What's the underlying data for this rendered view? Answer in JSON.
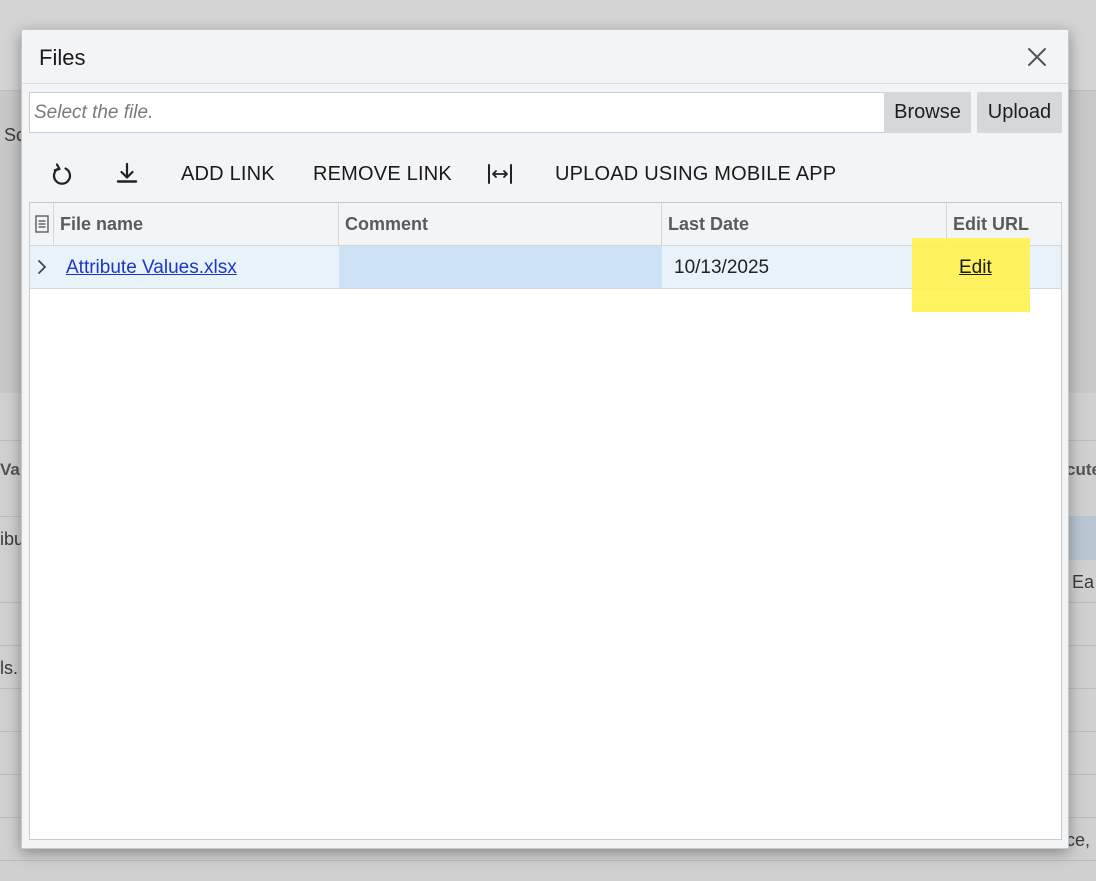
{
  "background": {
    "texts": [
      "Sc",
      "Val",
      "ibu",
      "ls.",
      "cute",
      "Ea",
      "ce, "
    ]
  },
  "dialog": {
    "title": "Files",
    "close_icon": "close-icon"
  },
  "file_select": {
    "placeholder": "Select the file.",
    "browse_label": "Browse",
    "upload_label": "Upload"
  },
  "toolbar": {
    "refresh_icon": "refresh-icon",
    "download_icon": "download-icon",
    "add_link_label": "ADD LINK",
    "remove_link_label": "REMOVE LINK",
    "fit_columns_icon": "fit-columns-icon",
    "mobile_upload_label": "UPLOAD USING MOBILE APP"
  },
  "grid": {
    "columns": [
      "File name",
      "Comment",
      "Last Date",
      "Edit URL"
    ],
    "rows": [
      {
        "file_name": "Attribute Values.xlsx",
        "comment": "",
        "last_date": "10/13/2025",
        "edit_url": "Edit"
      }
    ]
  },
  "colors": {
    "link": "#1d35c6",
    "selected_row": "#e8f2fb",
    "selected_cell": "#cde3f5",
    "highlight": "#fff24d"
  }
}
